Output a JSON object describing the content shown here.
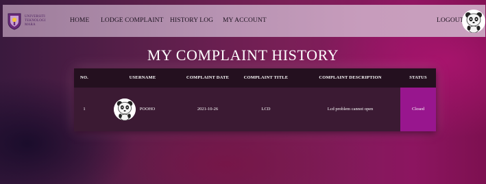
{
  "nav": {
    "logo_text": [
      "UNIVERSITI",
      "TEKNOLOGI",
      "MARA"
    ],
    "links": [
      "HOME",
      "LODGE COMPLAINT",
      "HISTORY LOG",
      "MY ACCOUNT"
    ],
    "logout": "LOGOUT"
  },
  "page": {
    "title": "MY COMPLAINT HISTORY"
  },
  "table": {
    "headers": [
      "NO.",
      "USERNAME",
      "COMPLAINT DATE",
      "COMPLAINT TITLE",
      "COMPLAINT DESCRIPTION",
      "STATUS"
    ],
    "rows": [
      {
        "no": "1",
        "username": "POOHO",
        "date": "2021-10-26",
        "title": "LCD",
        "description": "Lcd problem cannot open",
        "status": "Closed"
      }
    ]
  },
  "colors": {
    "status_closed": "#98168e",
    "nav_bg": "#b793b2",
    "title_text": "#ffffff"
  },
  "icons": {
    "logo": "uitm-crest-icon",
    "avatar": "panda-avatar-icon"
  }
}
